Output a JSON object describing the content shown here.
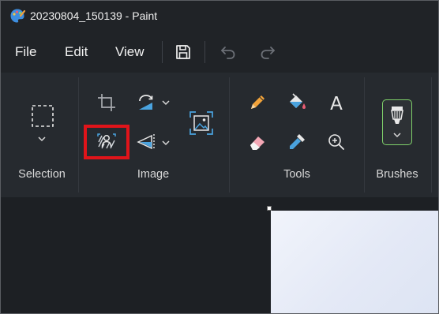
{
  "window": {
    "title": "20230804_150139 - Paint",
    "app_icon": "paint-palette-icon"
  },
  "menu": {
    "items": [
      "File",
      "Edit",
      "View"
    ],
    "quick_access": [
      "save-icon",
      "undo-icon",
      "redo-icon"
    ]
  },
  "ribbon": {
    "groups": [
      {
        "label": "Selection",
        "tools": [
          "rectangle-select-icon",
          "chevron-down-icon"
        ]
      },
      {
        "label": "Image",
        "tools": [
          "crop-icon",
          "rotate-icon",
          "image-background-icon",
          "flip-icon",
          "resize-icon"
        ]
      },
      {
        "label": "Tools",
        "tools": [
          "pencil-icon",
          "fill-bucket-icon",
          "text-icon",
          "eraser-icon",
          "color-picker-icon",
          "magnifier-icon"
        ]
      },
      {
        "label": "Brushes",
        "tools": [
          "brush-icon",
          "chevron-down-icon"
        ]
      }
    ],
    "text_tool_glyph": "A"
  },
  "colors": {
    "background": "#1f2227",
    "ribbon": "#262a2f",
    "accent_green": "#7fd16a",
    "highlight_red": "#e0141a",
    "icon_blue": "#4aa3df",
    "icon_orange": "#f2a33a"
  }
}
